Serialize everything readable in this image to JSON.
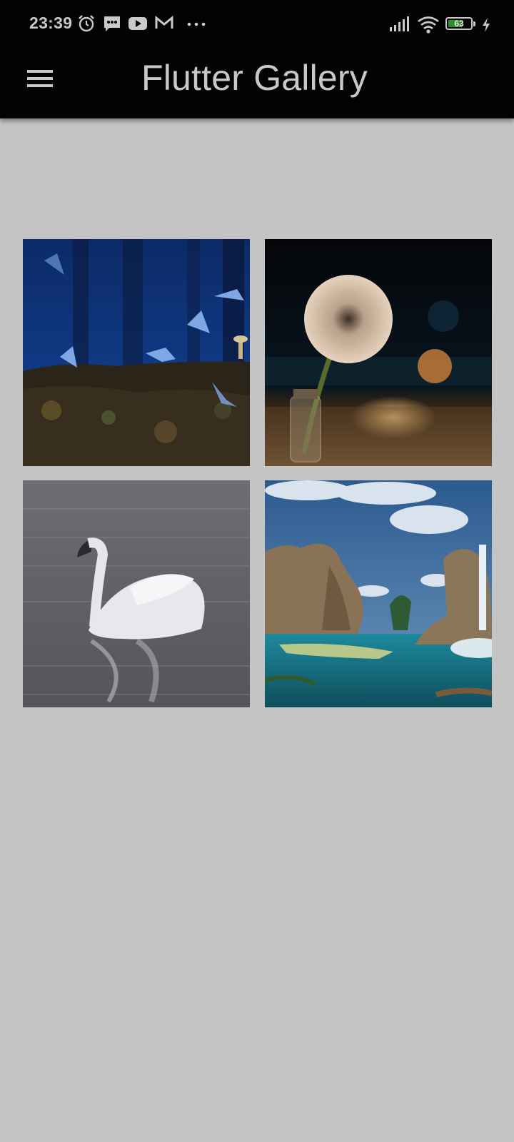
{
  "status_bar": {
    "time": "23:39",
    "battery_level": 63,
    "battery_text": "63",
    "icons": [
      "alarm-icon",
      "message-icon",
      "youtube-icon",
      "gmail-icon",
      "more-dots-icon",
      "signal-icon",
      "wifi-icon",
      "battery-icon",
      "charging-icon"
    ]
  },
  "app_bar": {
    "title": "Flutter Gallery",
    "menu_icon": "hamburger-menu-icon"
  },
  "gallery": {
    "images": [
      {
        "subject": "blue butterflies in a dark forest"
      },
      {
        "subject": "dandelion in a glass bottle at sunset"
      },
      {
        "subject": "white swan on water"
      },
      {
        "subject": "fantasy rock island with waterfall"
      }
    ]
  },
  "colors": {
    "status_bar_bg": "#030303",
    "app_bar_bg": "#030303",
    "body_bg": "#c4c4c4",
    "title_text": "#c8c8c8",
    "battery_fill": "#2f8f2f"
  }
}
